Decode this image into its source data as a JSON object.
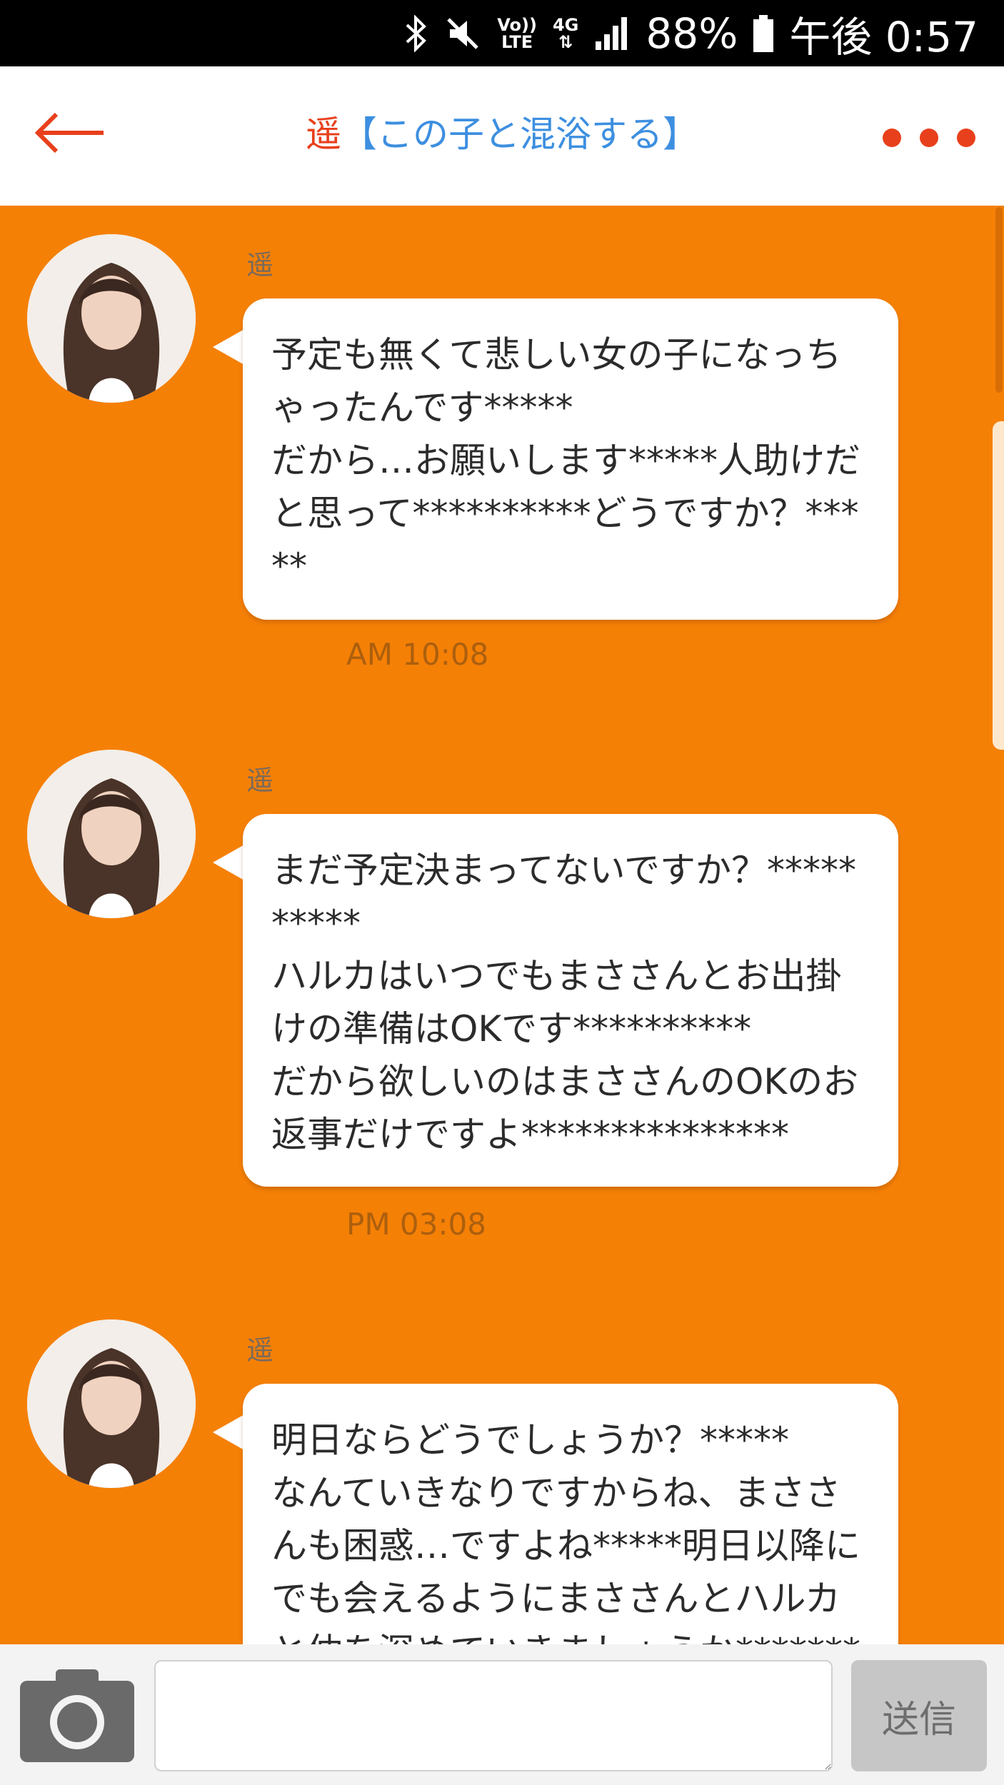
{
  "status_bar": {
    "bluetooth_icon": "bluetooth-icon",
    "mute_icon": "mute-icon",
    "volte_label_top": "Vo))",
    "volte_label_bottom": "LTE",
    "network_label": "4G",
    "battery_percent": "88%",
    "time": "午後 0:57"
  },
  "header": {
    "title_name": "遥",
    "title_link": "【この子と混浴する】"
  },
  "messages": [
    {
      "sender": "遥",
      "text": "予定も無くて悲しい女の子になっちゃったんです*****\nだから…お願いします*****人助けだと思って**********どうですか？*****",
      "time": "AM 10:08"
    },
    {
      "sender": "遥",
      "text": "まだ予定決まってないですか？**********\nハルカはいつでもまささんとお出掛けの準備はOKです**********\nだから欲しいのはまささんのOKのお返事だけですよ***************",
      "time": "PM 03:08"
    },
    {
      "sender": "遥",
      "text": "明日ならどうでしょうか？*****\nなんていきなりですからね、まささんも困惑…ですよね*****明日以降にでも会えるようにまささんとハルカと仲を深めていきましょうか**********",
      "time": ""
    }
  ],
  "input_bar": {
    "input_value": "",
    "send_label": "送信"
  },
  "colors": {
    "background": "#f58006",
    "accent": "#e8401c",
    "link": "#3d8fe0"
  }
}
